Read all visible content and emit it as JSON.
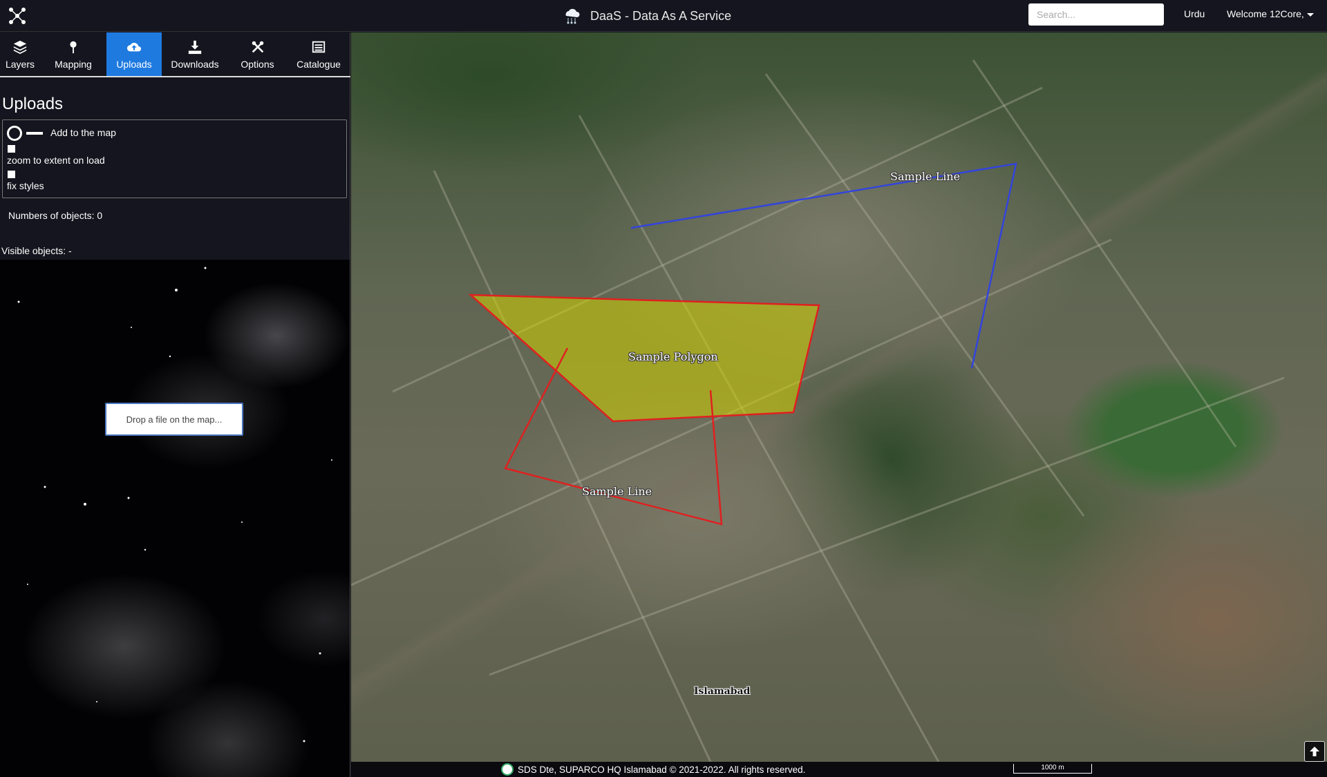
{
  "header": {
    "title": "DaaS - Data As A Service",
    "search_placeholder": "Search...",
    "language_label": "Urdu",
    "user_label": "Welcome 12Core,"
  },
  "tabs": [
    {
      "label": "Layers",
      "icon": "layers-icon",
      "active": false
    },
    {
      "label": "Mapping",
      "icon": "map-pin-icon",
      "active": false
    },
    {
      "label": "Uploads",
      "icon": "cloud-upload-icon",
      "active": true
    },
    {
      "label": "Downloads",
      "icon": "download-icon",
      "active": false
    },
    {
      "label": "Options",
      "icon": "tools-icon",
      "active": false
    },
    {
      "label": "Catalogue",
      "icon": "list-icon",
      "active": false
    }
  ],
  "uploads": {
    "title": "Uploads",
    "add_to_map_label": "Add to the map",
    "zoom_label": "zoom to extent on load",
    "fix_styles_label": "fix styles",
    "objects_count": "Numbers of objects: 0",
    "visible_objects": "Visible objects: -",
    "drop_text": "Drop a file on the map..."
  },
  "map": {
    "labels": {
      "sample_line_top": "Sample Line",
      "sample_polygon": "Sample Polygon",
      "sample_line_bottom": "Sample Line",
      "city": "Islamabad"
    },
    "colors": {
      "polygon_fill": "#d4d400",
      "polygon_stroke": "#e02020",
      "line_red": "#e02020",
      "line_blue": "#3344dd"
    }
  },
  "footer": {
    "copyright": "SDS Dte, SUPARCO HQ Islamabad © 2021-2022. All rights reserved.",
    "scale_label": "1000 m"
  }
}
